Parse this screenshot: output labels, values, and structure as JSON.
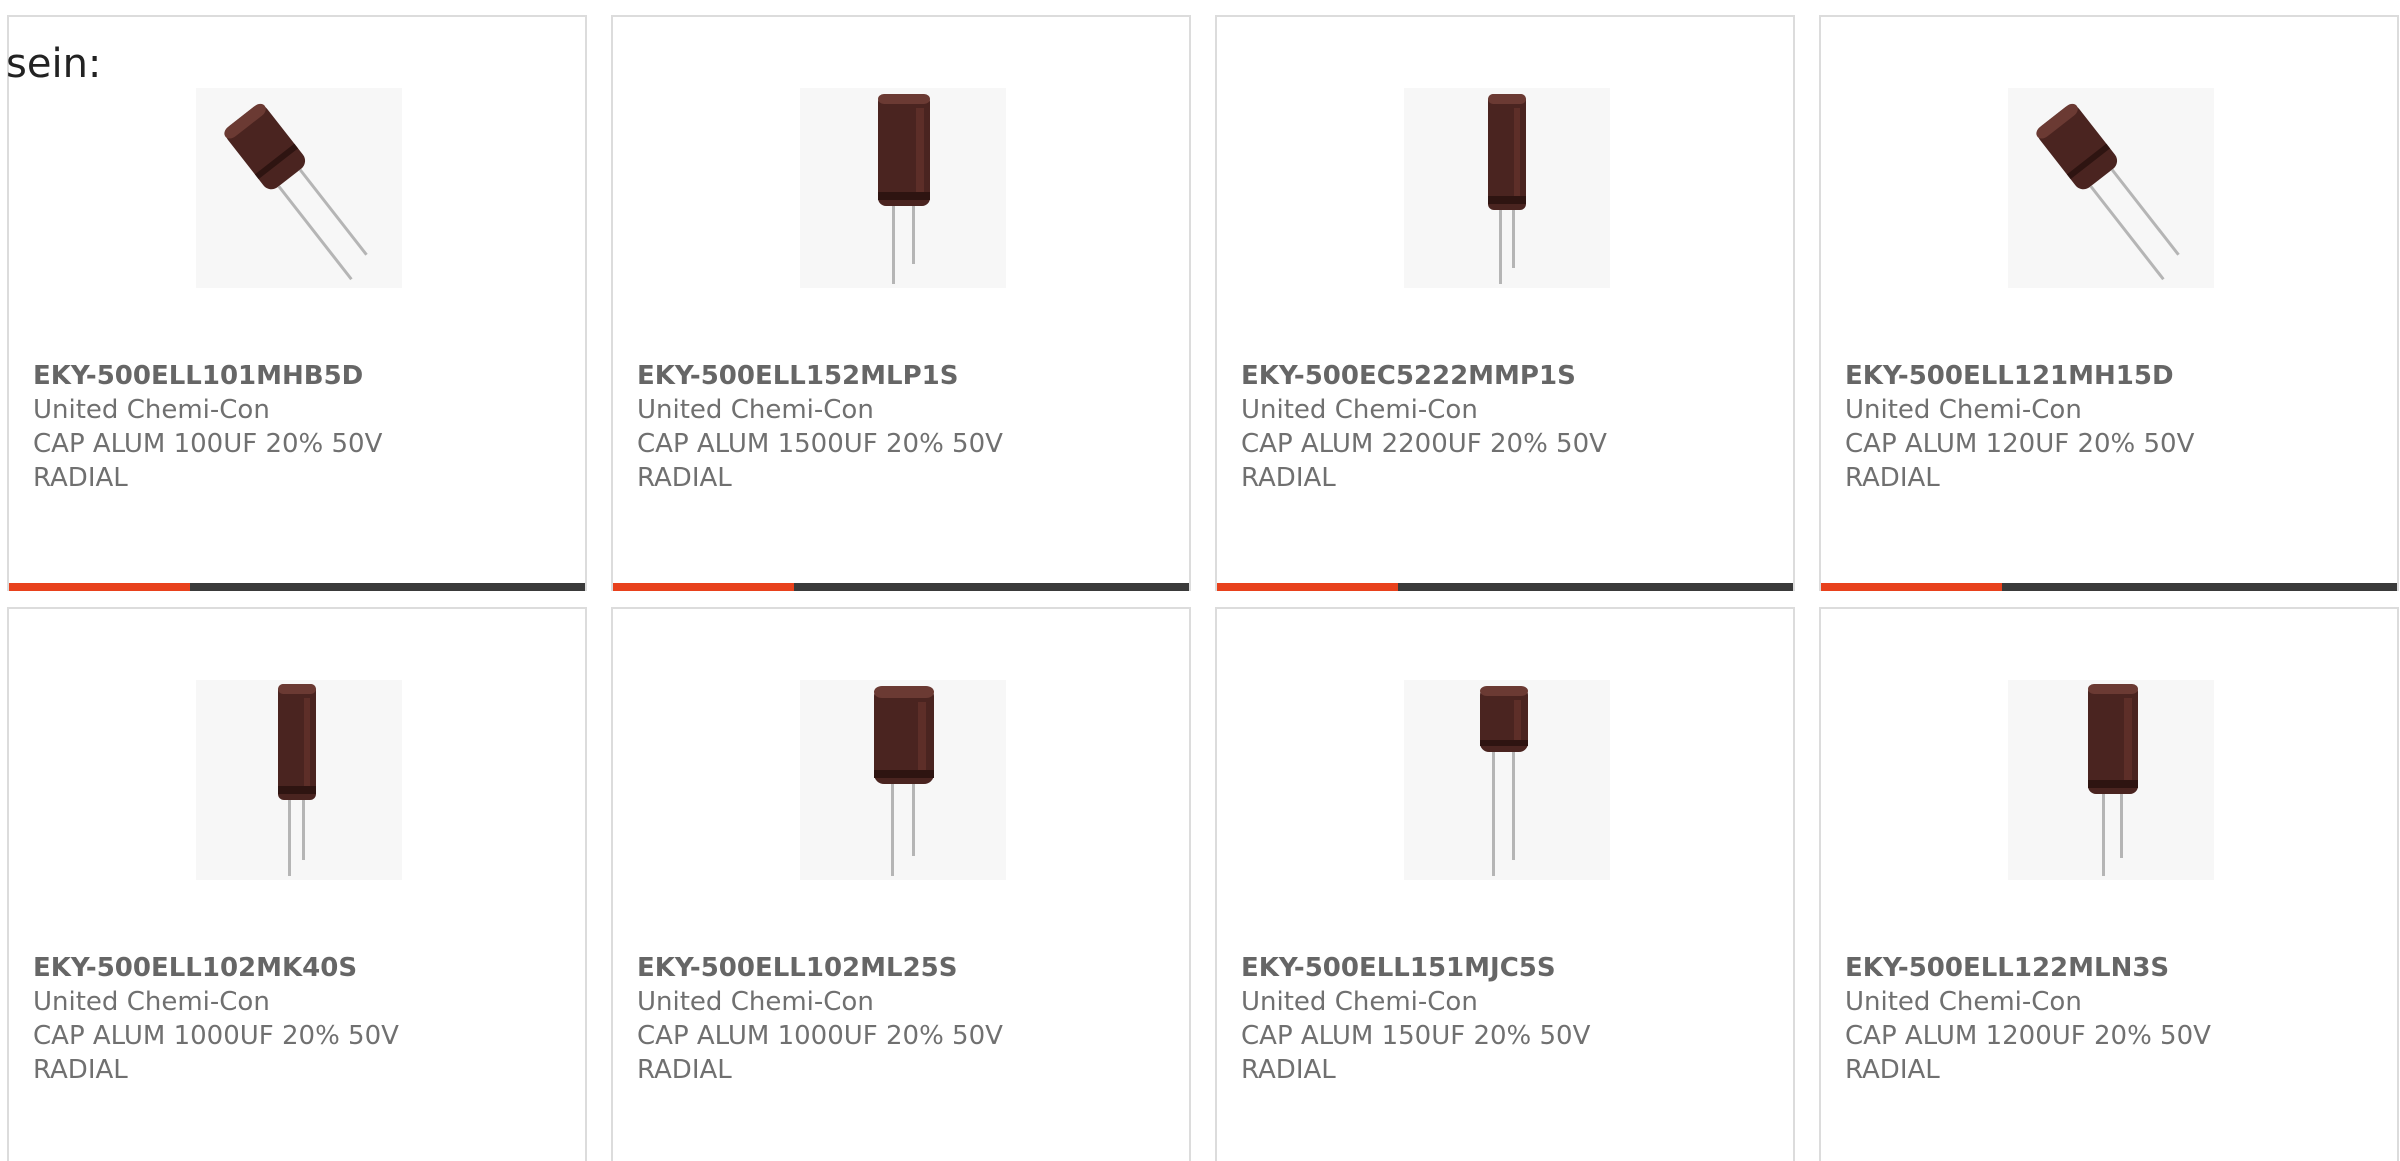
{
  "intro_text": "sein:",
  "colors": {
    "accent": "#e8411c",
    "bar_dark": "#3a3a3a",
    "capacitor_body": "#4a2420"
  },
  "products": [
    {
      "part_number": "EKY-500ELL101MHB5D",
      "manufacturer": "United Chemi-Con",
      "description_line1": "CAP ALUM 100UF 20% 50V",
      "description_line2": "RADIAL",
      "image_icon": "capacitor-tilted-icon"
    },
    {
      "part_number": "EKY-500ELL152MLP1S",
      "manufacturer": "United Chemi-Con",
      "description_line1": "CAP ALUM 1500UF 20% 50V",
      "description_line2": "RADIAL",
      "image_icon": "capacitor-tall-icon"
    },
    {
      "part_number": "EKY-500EC5222MMP1S",
      "manufacturer": "United Chemi-Con",
      "description_line1": "CAP ALUM 2200UF 20% 50V",
      "description_line2": "RADIAL",
      "image_icon": "capacitor-slim-icon"
    },
    {
      "part_number": "EKY-500ELL121MH15D",
      "manufacturer": "United Chemi-Con",
      "description_line1": "CAP ALUM 120UF 20% 50V",
      "description_line2": "RADIAL",
      "image_icon": "capacitor-tilted-icon"
    },
    {
      "part_number": "EKY-500ELL102MK40S",
      "manufacturer": "United Chemi-Con",
      "description_line1": "CAP ALUM 1000UF 20% 50V",
      "description_line2": "RADIAL",
      "image_icon": "capacitor-slim-icon"
    },
    {
      "part_number": "EKY-500ELL102ML25S",
      "manufacturer": "United Chemi-Con",
      "description_line1": "CAP ALUM 1000UF 20% 50V",
      "description_line2": "RADIAL",
      "image_icon": "capacitor-wide-icon"
    },
    {
      "part_number": "EKY-500ELL151MJC5S",
      "manufacturer": "United Chemi-Con",
      "description_line1": "CAP ALUM 150UF 20% 50V",
      "description_line2": "RADIAL",
      "image_icon": "capacitor-short-icon"
    },
    {
      "part_number": "EKY-500ELL122MLN3S",
      "manufacturer": "United Chemi-Con",
      "description_line1": "CAP ALUM 1200UF 20% 50V",
      "description_line2": "RADIAL",
      "image_icon": "capacitor-tall-icon"
    }
  ]
}
